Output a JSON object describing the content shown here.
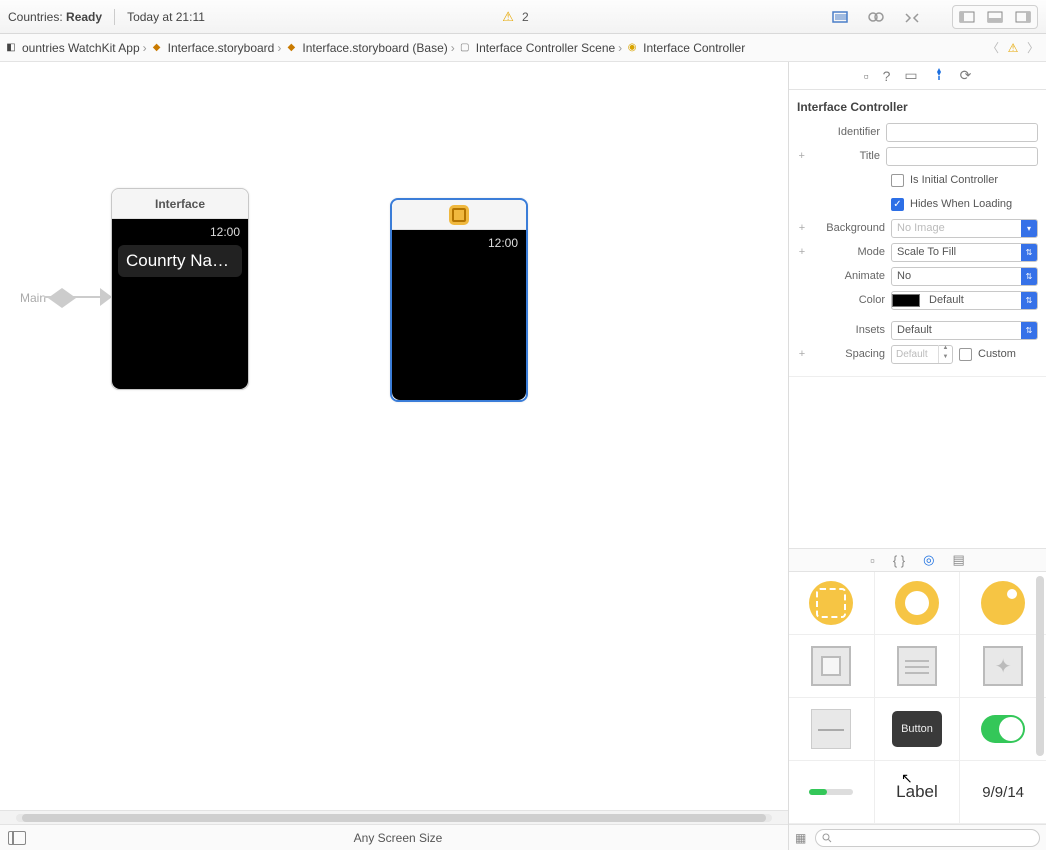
{
  "toolbar": {
    "project": "Countries",
    "status": "Ready",
    "time_label": "Today at 21:11",
    "warning_count": "2"
  },
  "breadcrumbs": {
    "items": [
      "ountries WatchKit App",
      "Interface.storyboard",
      "Interface.storyboard (Base)",
      "Interface Controller Scene",
      "Interface Controller"
    ]
  },
  "canvas": {
    "entry_label": "Main",
    "scene1": {
      "title": "Interface",
      "time": "12:00",
      "row_text": "Counrty Na…"
    },
    "scene2": {
      "time": "12:00"
    },
    "footer": "Any Screen Size"
  },
  "inspector": {
    "heading": "Interface Controller",
    "identifier_label": "Identifier",
    "identifier_value": "",
    "title_label": "Title",
    "title_value": "",
    "is_initial_label": "Is Initial Controller",
    "hides_label": "Hides When Loading",
    "background_label": "Background",
    "background_value": "No Image",
    "mode_label": "Mode",
    "mode_value": "Scale To Fill",
    "animate_label": "Animate",
    "animate_value": "No",
    "color_label": "Color",
    "color_value": "Default",
    "insets_label": "Insets",
    "insets_value": "Default",
    "spacing_label": "Spacing",
    "spacing_value": "Default",
    "custom_label": "Custom"
  },
  "library": {
    "button_text": "Button",
    "label_text": "Label",
    "date_text": "9/9/14"
  }
}
